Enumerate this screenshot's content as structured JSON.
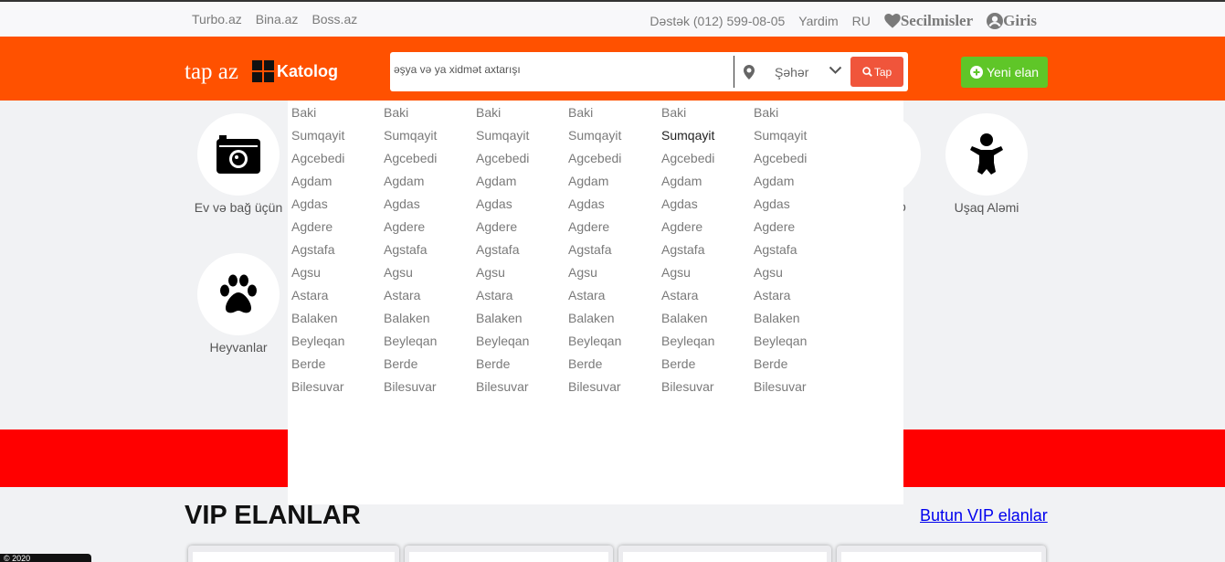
{
  "topbar": {
    "links": [
      "Turbo.az",
      "Bina.az",
      "Boss.az"
    ],
    "support": "Dəstək (012) 599-08-05",
    "help": "Yardim",
    "lang": "RU",
    "favorites": "Secilmisler",
    "login": "Giris"
  },
  "header": {
    "logo": "tap az",
    "catalog": "Katolog",
    "search_placeholder": "əşya və ya xidmət axtarışı",
    "city": "Şəhər",
    "search_button": "Tap",
    "new_ad": "Yeni elan"
  },
  "categories": {
    "home": "Ev və bağ üçün",
    "kids": "Uşaq Aləmi",
    "pets": "Heyvanlar",
    "partial": "o"
  },
  "dropdown": {
    "cities": [
      "Baki",
      "Sumqayit",
      "Agcebedi",
      "Agdam",
      "Agdas",
      "Agdere",
      "Agstafa",
      "Agsu",
      "Astara",
      "Balaken",
      "Beyleqan",
      "Berde",
      "Bilesuvar"
    ],
    "columns": 6,
    "highlighted": {
      "column": 4,
      "item": "Sumqayit"
    }
  },
  "vip": {
    "title": "VIP ELANLAR",
    "all_link": "Butun VIP elanlar"
  },
  "badge": "© 2020"
}
